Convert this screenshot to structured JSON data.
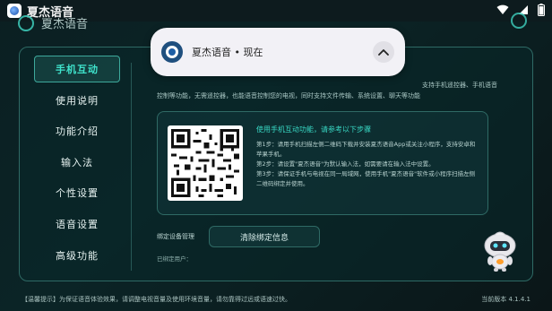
{
  "statusbar": {
    "app_title": "夏杰语音",
    "icons": [
      "wifi-icon",
      "signal-icon",
      "battery-icon"
    ]
  },
  "header": {
    "app_name": "夏杰语音"
  },
  "notification": {
    "text": "夏杰语音 • 现在",
    "expand_icon": "chevron-up-icon"
  },
  "sidebar": {
    "items": [
      {
        "label": "手机互动",
        "active": true
      },
      {
        "label": "使用说明",
        "active": false
      },
      {
        "label": "功能介绍",
        "active": false
      },
      {
        "label": "输入法",
        "active": false
      },
      {
        "label": "个性设置",
        "active": false
      },
      {
        "label": "语音设置",
        "active": false
      },
      {
        "label": "高级功能",
        "active": false
      }
    ]
  },
  "intro": {
    "line1_right": "支持手机遥控器、手机语音",
    "line2": "控制等功能，无需遥控器，也能语音控制您的电视，同时支持文件传输、系统设置、聊天等功能"
  },
  "qr_card": {
    "heading": "使用手机互动功能，请参考以下步骤",
    "steps": [
      "第1步：请用手机扫描左侧二维码下载并安装夏杰语音App或关注小程序，支持安卓和苹果手机。",
      "第2步：请设置\"夏杰语音\"为默认输入法，如需要请在输入法中设置。",
      "第3步：请保证手机与电视在同一局域网，使用手机\"夏杰语音\"软件或小程序扫描左侧二维码绑定并使用。"
    ]
  },
  "device_manage": {
    "label": "绑定设备管理",
    "clear_button": "清除绑定信息",
    "bound_user": "已绑定用户："
  },
  "footer": {
    "tip": "【温馨提示】为保证语音体验效果，请调整电视音量及使用环境音量，请勿靠得过远或语速过快。",
    "version": "当前版本 4.1.4.1"
  },
  "colors": {
    "accent": "#3fe3cc",
    "panel_border": "#2f6a65",
    "background": "#0b1f22"
  }
}
